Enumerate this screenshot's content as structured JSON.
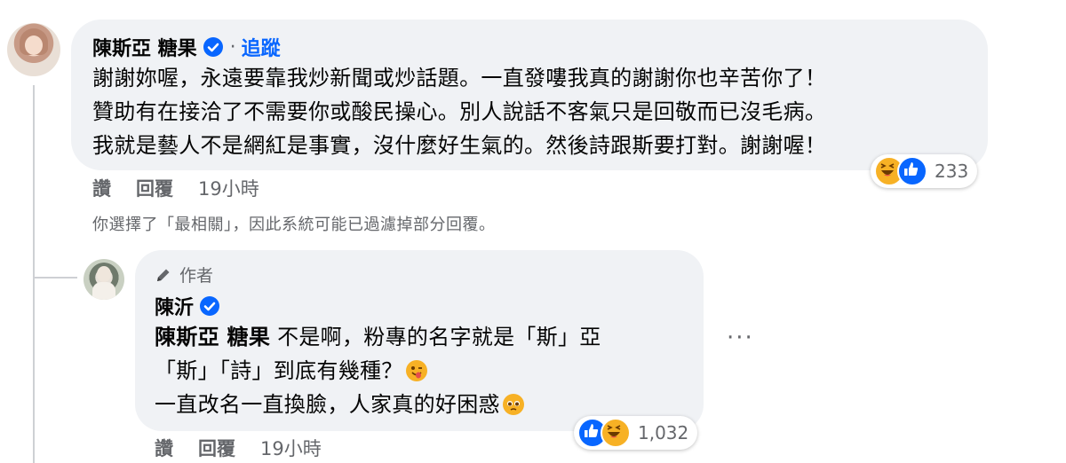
{
  "comment": {
    "author": "陳斯亞 糖果",
    "separator": "·",
    "follow_label": "追蹤",
    "lines": [
      "謝謝妳喔，永遠要靠我炒新聞或炒話題。一直發嘍我真的謝謝你也辛苦你了！",
      "贊助有在接洽了不需要你或酸民操心。別人說話不客氣只是回敬而已沒毛病。",
      "我就是藝人不是網紅是事實，沒什麼好生氣的。然後詩跟斯要打對。謝謝喔！"
    ],
    "reaction_count": "233",
    "reaction_icons": [
      "haha-icon",
      "like-icon"
    ],
    "like_label": "讚",
    "reply_label": "回覆",
    "time": "19小時"
  },
  "filter_notice": "你選擇了「最相關」，因此系統可能已過濾掉部分回覆。",
  "reply": {
    "author_badge": "作者",
    "author": "陳沂",
    "mention": "陳斯亞 糖果",
    "line1_rest": " 不是啊，粉專的名字就是「斯」亞",
    "line2": "「斯」「詩」到底有幾種？",
    "line3": "一直改名一直換臉，人家真的好困惑",
    "line2_emoji": "winking-tongue-emoji",
    "line3_emoji": "pleading-face-emoji",
    "reaction_count": "1,032",
    "reaction_icons": [
      "like-icon",
      "haha-icon"
    ],
    "like_label": "讚",
    "reply_label": "回覆",
    "time": "19小時",
    "more_label": "···"
  },
  "colors": {
    "bubble": "#f0f2f5",
    "link_blue": "#0866ff",
    "secondary_text": "#65676b",
    "haha_yellow": "#f7b125"
  }
}
